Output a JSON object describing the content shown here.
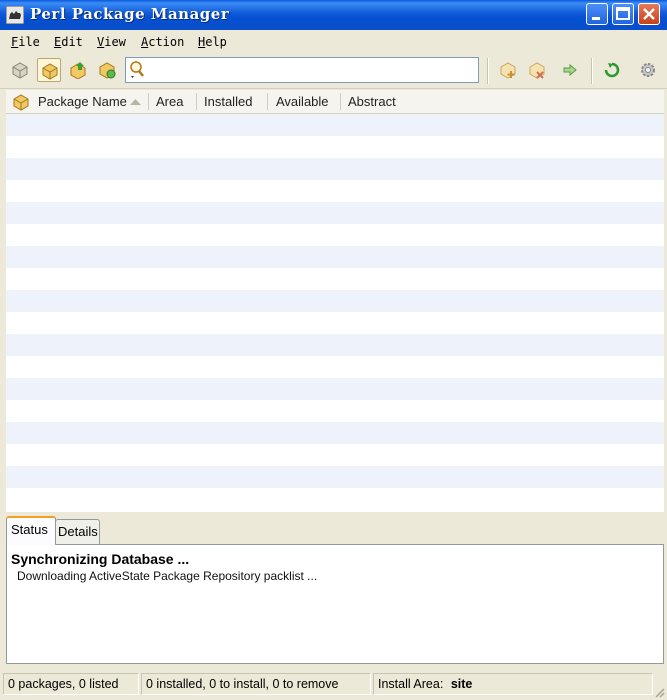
{
  "window": {
    "title": "Perl Package Manager",
    "icon": "camel-icon",
    "controls": [
      "minimize",
      "maximize",
      "close"
    ]
  },
  "menu": [
    {
      "accel": "F",
      "rest": "ile"
    },
    {
      "accel": "E",
      "rest": "dit"
    },
    {
      "accel": "V",
      "rest": "iew"
    },
    {
      "accel": "A",
      "rest": "ction"
    },
    {
      "accel": "H",
      "rest": "elp"
    }
  ],
  "toolbar": {
    "left_icons": [
      "all-packages-icon",
      "installed-packages-icon",
      "upgradeable-packages-icon",
      "modified-packages-icon"
    ],
    "search": {
      "value": "",
      "icon": "search-icon"
    },
    "right_icons": [
      "mark-install-icon",
      "mark-remove-icon",
      "run-actions-icon",
      "refresh-icon",
      "preferences-icon"
    ]
  },
  "columns": [
    "Package Name",
    "Area",
    "Installed",
    "Available",
    "Abstract"
  ],
  "rows": [],
  "tabs": {
    "status": "Status",
    "details": "Details"
  },
  "status": {
    "heading": "Synchronizing Database ...",
    "detail": "Downloading ActiveState Package Repository packlist ..."
  },
  "statusbar": {
    "packages": "0 packages, 0 listed",
    "changes": "0 installed, 0 to install, 0 to remove",
    "area_label": "Install Area:",
    "area_value": "site"
  },
  "colors": {
    "title_bar": "#0a58e0",
    "stripe": "#eef3fb",
    "chrome": "#ece9d8"
  }
}
